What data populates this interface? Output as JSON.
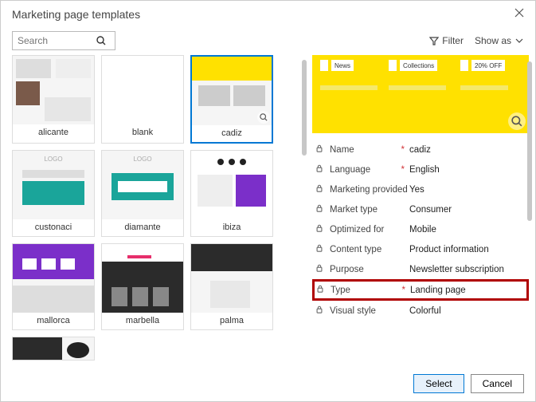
{
  "header": {
    "title": "Marketing page templates"
  },
  "toolbar": {
    "search_placeholder": "Search",
    "filter_label": "Filter",
    "showas_label": "Show as"
  },
  "gallery": {
    "items": [
      {
        "name": "alicante"
      },
      {
        "name": "blank"
      },
      {
        "name": "cadiz",
        "selected": true
      },
      {
        "name": "custonaci"
      },
      {
        "name": "diamante"
      },
      {
        "name": "ibiza"
      },
      {
        "name": "mallorca"
      },
      {
        "name": "marbella"
      },
      {
        "name": "palma"
      }
    ]
  },
  "preview": {
    "tabs": [
      "News",
      "Collections",
      "20% OFF"
    ]
  },
  "properties": [
    {
      "label": "Name",
      "required": true,
      "value": "cadiz"
    },
    {
      "label": "Language",
      "required": true,
      "value": "English"
    },
    {
      "label": "Marketing provided",
      "required": false,
      "value": "Yes"
    },
    {
      "label": "Market type",
      "required": false,
      "value": "Consumer"
    },
    {
      "label": "Optimized for",
      "required": false,
      "value": "Mobile"
    },
    {
      "label": "Content type",
      "required": false,
      "value": "Product information"
    },
    {
      "label": "Purpose",
      "required": false,
      "value": "Newsletter subscription"
    },
    {
      "label": "Type",
      "required": true,
      "value": "Landing page",
      "highlight": true
    },
    {
      "label": "Visual style",
      "required": false,
      "value": "Colorful"
    }
  ],
  "footer": {
    "select": "Select",
    "cancel": "Cancel"
  }
}
